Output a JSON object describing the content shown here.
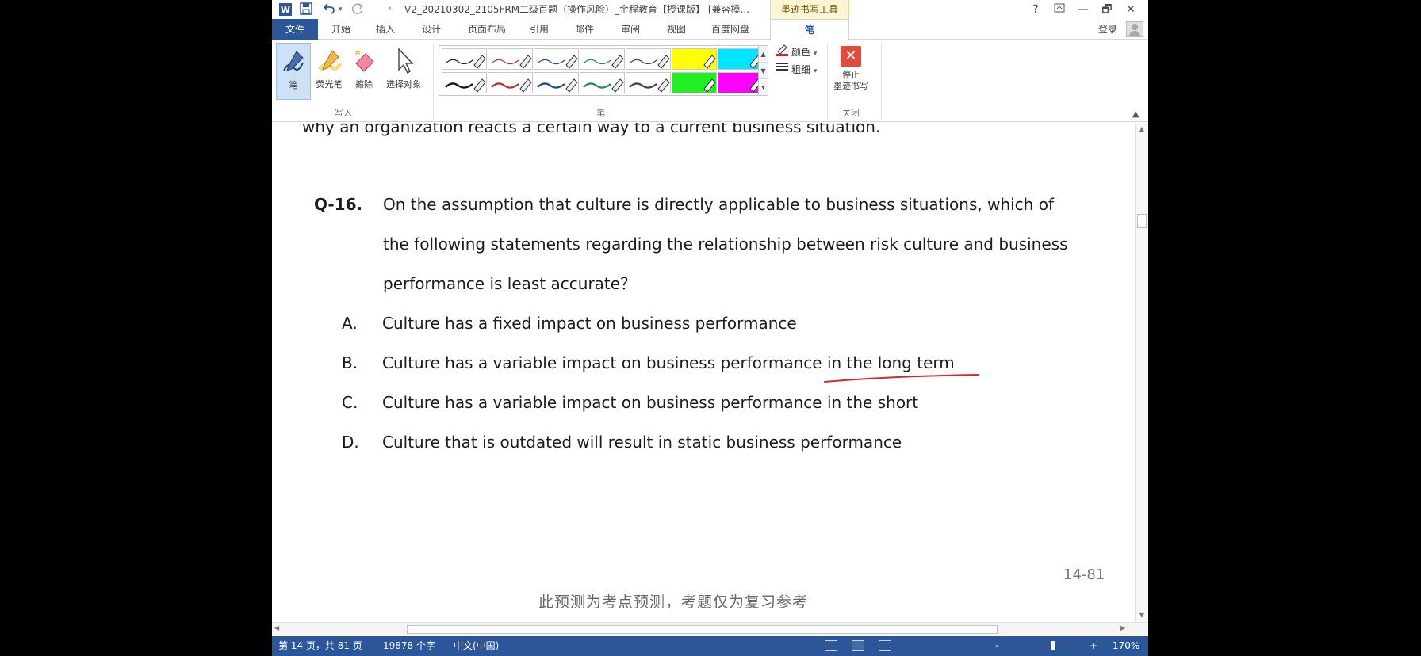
{
  "title_bar": {
    "doc_title": "V2_20210302_2105FRM二级百题（操作风险）_金程教育【授课版】 [兼容模...",
    "context_tab_group": "墨迹书写工具",
    "help": "?",
    "min": "—",
    "restore": "🗗",
    "close": "✕"
  },
  "tabs": {
    "file": "文件",
    "items": [
      "开始",
      "插入",
      "设计",
      "页面布局",
      "引用",
      "邮件",
      "审阅",
      "视图",
      "百度网盘"
    ],
    "active": "笔",
    "login": "登录"
  },
  "ribbon": {
    "write_group": {
      "label": "写入",
      "buttons": [
        "笔",
        "荧光笔",
        "擦除",
        "选择对象"
      ]
    },
    "pens_group": {
      "label": "笔",
      "pens": [
        {
          "color": "#222222",
          "kind": "pen",
          "thickness": 1
        },
        {
          "color": "#cc2a2a",
          "kind": "pen",
          "thickness": 1
        },
        {
          "color": "#1e4e8c",
          "kind": "pen",
          "thickness": 1
        },
        {
          "color": "#1f8f4f",
          "kind": "pen",
          "thickness": 1
        },
        {
          "color": "#444444",
          "kind": "pen",
          "thickness": 1
        },
        {
          "color": "#ffff00",
          "kind": "highlighter"
        },
        {
          "color": "#00e5ff",
          "kind": "highlighter"
        },
        {
          "color": "#111111",
          "kind": "pen",
          "thickness": 2
        },
        {
          "color": "#cc2a2a",
          "kind": "pen",
          "thickness": 2
        },
        {
          "color": "#1e4e8c",
          "kind": "pen",
          "thickness": 2
        },
        {
          "color": "#1f8f4f",
          "kind": "pen",
          "thickness": 2
        },
        {
          "color": "#444444",
          "kind": "pen",
          "thickness": 2
        },
        {
          "color": "#22ee22",
          "kind": "highlighter"
        },
        {
          "color": "#ff00ff",
          "kind": "highlighter"
        }
      ],
      "color_label": "颜色",
      "thickness_label": "粗细"
    },
    "close_group": {
      "label": "关闭",
      "stop_line1": "停止",
      "stop_line2": "墨迹书写"
    }
  },
  "document": {
    "prev_text": "why an organization reacts a certain way to a current business situation.",
    "question_label": "Q-16.",
    "question_lines": [
      "On the assumption that culture is directly applicable to business situations, which of",
      "the following statements regarding the relationship between risk culture and business",
      "performance is least accurate？"
    ],
    "options": [
      {
        "letter": "A.",
        "text": "Culture has a fixed impact on business performance"
      },
      {
        "letter": "B.",
        "text": "Culture has a variable impact on business performance in the long term"
      },
      {
        "letter": "C.",
        "text": "Culture has a variable impact on business performance in the short"
      },
      {
        "letter": "D.",
        "text": "Culture that is outdated will result in static business performance"
      }
    ],
    "annotation_color": "#d22a2a",
    "page_number": "14-81",
    "footer_note": "此预测为考点预测，考题仅为复习参考"
  },
  "status_bar": {
    "page": "第 14 页，共 81 页",
    "words": "19878 个字",
    "language": "中文(中国)",
    "zoom_minus": "-",
    "zoom_plus": "+",
    "zoom_level": "170%",
    "zoom_fraction": 0.62
  }
}
